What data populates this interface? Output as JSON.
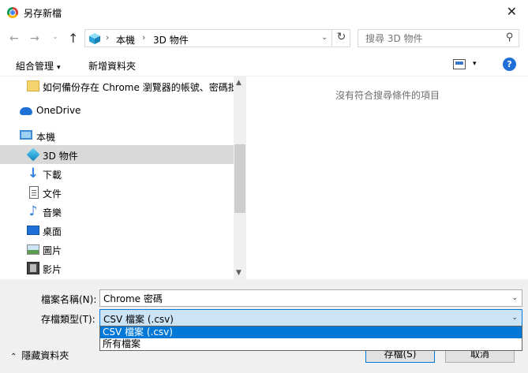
{
  "window": {
    "title": "另存新檔",
    "close_glyph": "✕"
  },
  "nav": {
    "back_glyph": "←",
    "forward_glyph": "→",
    "recent_glyph": "⌄",
    "up_glyph": "↑",
    "breadcrumb": [
      "本機",
      "3D 物件"
    ],
    "breadcrumb_sep": "›",
    "dropdown_glyph": "⌄",
    "refresh_glyph": "↻",
    "search_placeholder": "搜尋 3D 物件",
    "search_glyph": "⚲"
  },
  "toolbar": {
    "organize_label": "組合管理",
    "organize_caret": "▾",
    "new_folder_label": "新增資料夾",
    "view_caret": "▾",
    "help_label": "?"
  },
  "sidebar": {
    "items": [
      {
        "label": "如何備份存在 Chrome 瀏覽器的帳號、密碼批",
        "icon": "folder-icon"
      },
      {
        "label": "OneDrive",
        "icon": "onedrive-cloud-icon"
      },
      {
        "label": "本機",
        "icon": "computer-icon"
      },
      {
        "label": "3D 物件",
        "icon": "3d-objects-icon",
        "selected": true
      },
      {
        "label": "下載",
        "icon": "download-icon"
      },
      {
        "label": "文件",
        "icon": "documents-icon"
      },
      {
        "label": "音樂",
        "icon": "music-icon"
      },
      {
        "label": "桌面",
        "icon": "desktop-icon"
      },
      {
        "label": "圖片",
        "icon": "pictures-icon"
      },
      {
        "label": "影片",
        "icon": "videos-icon"
      }
    ],
    "scroll_up_glyph": "▲",
    "scroll_down_glyph": "▼"
  },
  "content": {
    "empty_message": "沒有符合搜尋條件的項目"
  },
  "form": {
    "filename_label": "檔案名稱(N):",
    "filename_value": "Chrome 密碼",
    "filetype_label": "存檔類型(T):",
    "filetype_value": "CSV 檔案 (.csv)",
    "caret_glyph": "⌄"
  },
  "dropdown": {
    "options": [
      "CSV 檔案 (.csv)",
      "所有檔案"
    ]
  },
  "buttons": {
    "hide_folders_label": "隱藏資料夾",
    "hide_folders_glyph": "⌃",
    "save_label": "存檔(S)",
    "cancel_label": "取消"
  },
  "colors": {
    "accent": "#0078d7",
    "selection": "#d9d9d9"
  }
}
